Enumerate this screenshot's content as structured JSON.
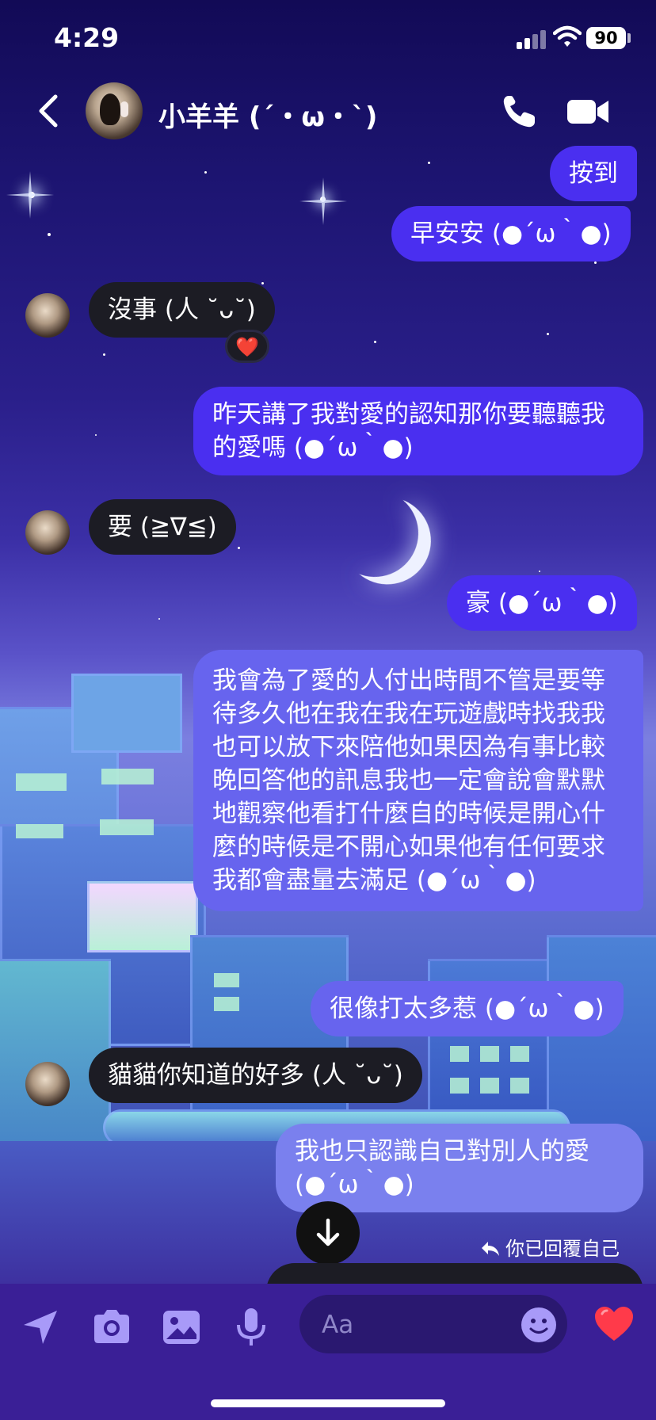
{
  "status_bar": {
    "time": "4:29",
    "battery": "90"
  },
  "header": {
    "contact_name": "小羊羊 (´・ω・`)"
  },
  "messages": [
    {
      "dir": "out",
      "text": "按到"
    },
    {
      "dir": "out",
      "text": "早安安 (●´ω｀●)"
    },
    {
      "dir": "in",
      "text": "沒事 (人 ˘ᴗ˘)",
      "reaction": "❤️"
    },
    {
      "dir": "out",
      "text": "昨天講了我對愛的認知那你要聽聽我的愛嗎 (●´ω｀●)"
    },
    {
      "dir": "in",
      "text": "要 (≧∇≦)"
    },
    {
      "dir": "out",
      "text": "豪 (●´ω｀●)"
    },
    {
      "dir": "out",
      "text": "我會為了愛的人付出時間不管是要等待多久他在我在我在玩遊戲時找我我也可以放下來陪他如果因為有事比較晚回答他的訊息我也一定會說會默默地觀察他看打什麼自的時候是開心什麼的時候是不開心如果他有任何要求我都會盡量去滿足 (●´ω｀●)"
    },
    {
      "dir": "out",
      "text": "很像打太多惹 (●´ω｀●)"
    },
    {
      "dir": "in",
      "text": "貓貓你知道的好多 (人 ˘ᴗ˘)"
    },
    {
      "dir": "out",
      "text": "我也只認識自己對別人的愛 (●´ω｀●)"
    }
  ],
  "reply_notice": "你已回覆自己",
  "composer": {
    "placeholder": "Aa"
  },
  "colors": {
    "outgoing": "#4a2ff0",
    "incoming": "#1c1c24",
    "accent": "#ff3a4a"
  },
  "icons": [
    "back-icon",
    "phone-icon",
    "video-icon",
    "send-location-icon",
    "camera-icon",
    "gallery-icon",
    "microphone-icon",
    "emoji-icon",
    "heart-icon",
    "arrow-down-icon"
  ]
}
